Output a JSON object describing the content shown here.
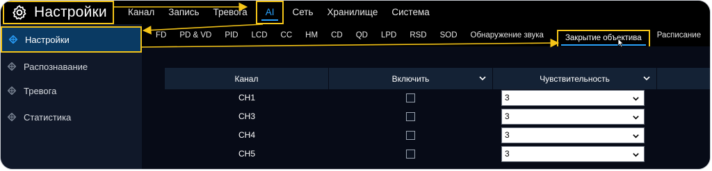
{
  "app": {
    "title": "Настройки",
    "colors": {
      "highlight": "#f5c518",
      "accent": "#2aa3ff",
      "bg": "#070b17"
    }
  },
  "topnav": {
    "items": [
      {
        "label": "Канал"
      },
      {
        "label": "Запись"
      },
      {
        "label": "Тревога"
      },
      {
        "label": "AI",
        "active": true
      },
      {
        "label": "Сеть"
      },
      {
        "label": "Хранилище"
      },
      {
        "label": "Система"
      }
    ]
  },
  "sidebar": {
    "items": [
      {
        "label": "Настройки",
        "active": true
      },
      {
        "label": "Распознавание"
      },
      {
        "label": "Тревога"
      },
      {
        "label": "Статистика"
      }
    ]
  },
  "subtabs": {
    "items": [
      {
        "label": "FD"
      },
      {
        "label": "PD & VD"
      },
      {
        "label": "PID"
      },
      {
        "label": "LCD"
      },
      {
        "label": "CC"
      },
      {
        "label": "HM"
      },
      {
        "label": "CD"
      },
      {
        "label": "QD"
      },
      {
        "label": "LPD"
      },
      {
        "label": "RSD"
      },
      {
        "label": "SOD"
      },
      {
        "label": "Обнаружение звука"
      },
      {
        "label": "Закрытие объектива",
        "active": true
      },
      {
        "label": "Расписание"
      }
    ]
  },
  "table": {
    "columns": [
      "Канал",
      "Включить",
      "Чувствительность"
    ],
    "rows": [
      {
        "channel": "CH1",
        "enabled": false,
        "sensitivity": "3"
      },
      {
        "channel": "CH3",
        "enabled": false,
        "sensitivity": "3"
      },
      {
        "channel": "CH4",
        "enabled": false,
        "sensitivity": "3"
      },
      {
        "channel": "CH5",
        "enabled": false,
        "sensitivity": "3"
      }
    ]
  },
  "icons": {
    "brand": "gear-icon",
    "sidebar_item": "diamond-bullet-icon",
    "dropdown": "chevron-down-icon",
    "pointer": "mouse-cursor-icon"
  }
}
